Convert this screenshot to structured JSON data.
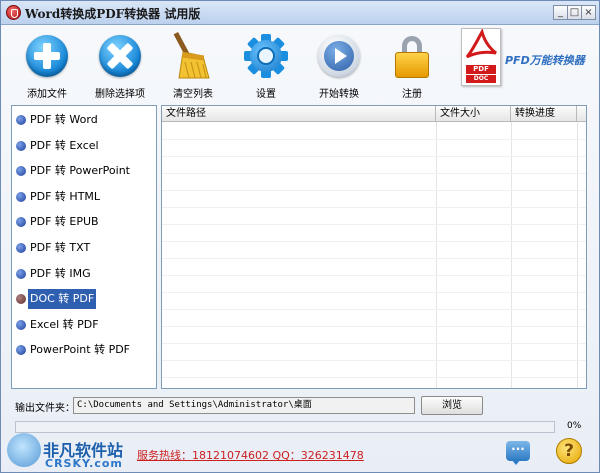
{
  "window": {
    "title": "Word转换成PDF转换器 试用版",
    "controls": {
      "minimize": "_",
      "maximize": "□",
      "close": "×"
    }
  },
  "toolbar": {
    "add_file": "添加文件",
    "delete_selected": "删除选择项",
    "clear_list": "清空列表",
    "settings": "设置",
    "start_convert": "开始转换",
    "register": "注册",
    "brand": "PFD万能转换器",
    "brand_pdf_tag": "PDF",
    "brand_doc_tag": "DOC"
  },
  "conversions": [
    "PDF 转 Word",
    "PDF 转 Excel",
    "PDF 转 PowerPoint",
    "PDF 转 HTML",
    "PDF 转 EPUB",
    "PDF 转 TXT",
    "PDF 转 IMG",
    "DOC 转 PDF",
    "Excel 转 PDF",
    "PowerPoint 转 PDF"
  ],
  "selected_conversion": "DOC 转 PDF",
  "table": {
    "columns": [
      "文件路径",
      "文件大小",
      "转换进度"
    ]
  },
  "output": {
    "label": "输出文件夹：",
    "path": "C:\\Documents and Settings\\Administrator\\桌面",
    "browse": "浏览"
  },
  "progress": {
    "value": 0,
    "label": "0%"
  },
  "footer": {
    "hotline": "服务热线：18121074602 QQ：326231478",
    "watermark_cn": "非凡软件站",
    "watermark_en": "CRSKY.com"
  },
  "colors": {
    "selection": "#2f5fb0",
    "hotline": "#cc1f1f",
    "progress_fill": "#3ea23e"
  }
}
